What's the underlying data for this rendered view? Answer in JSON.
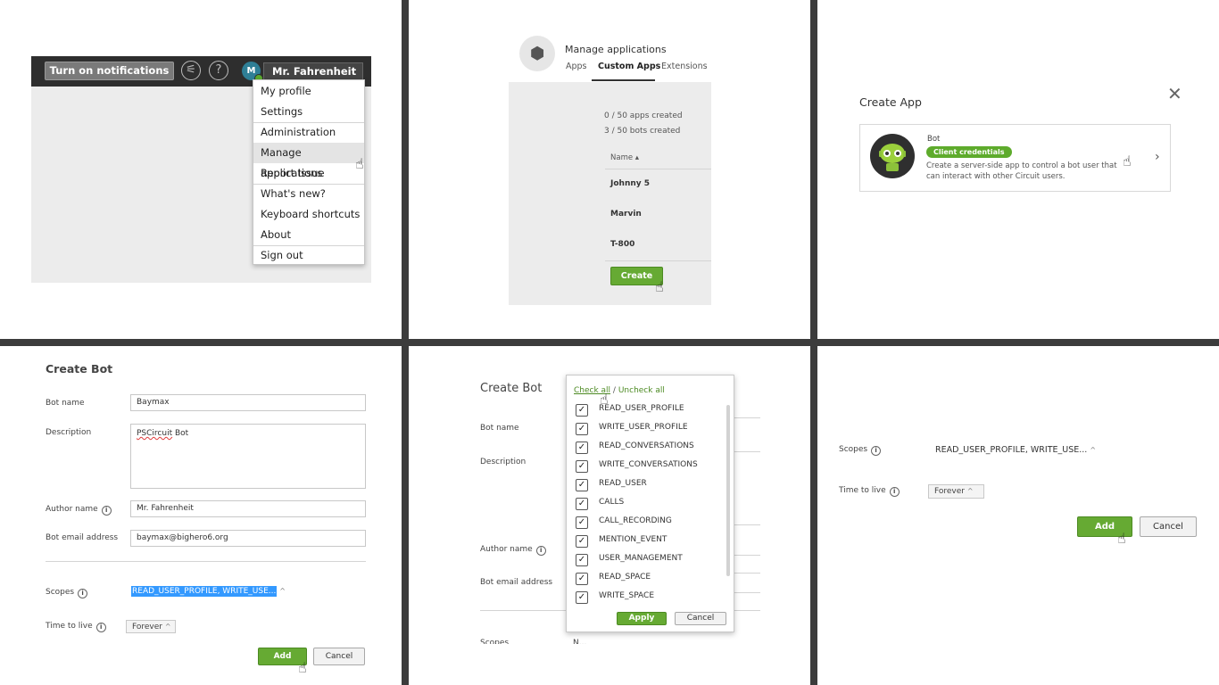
{
  "colors": {
    "brand_green": "#66aa33",
    "top_bar": "#2e2e2e",
    "selection_blue": "#3399ff",
    "badge_green": "#5eab2c"
  },
  "panel1": {
    "notifications_button": "Turn on notifications",
    "phone_icon": "⚟",
    "help_icon": "?",
    "avatar_initial": "M",
    "user_menu_button": "Mr. Fahrenheit",
    "user_menu_caret": "⌄",
    "menu": {
      "my_profile": "My profile",
      "settings": "Settings",
      "administration": "Administration",
      "manage_applications": "Manage applications",
      "report_issue": "Report Issue",
      "whats_new": "What's new?",
      "keyboard_shortcuts": "Keyboard shortcuts",
      "about": "About",
      "sign_out": "Sign out"
    }
  },
  "panel2": {
    "app_icon": "⬢",
    "title": "Manage applications",
    "tabs": {
      "apps": "Apps",
      "custom_apps": "Custom Apps",
      "extensions": "Extensions"
    },
    "apps_created": "0 / 50 apps created",
    "bots_created": "3 / 50 bots created",
    "name_header": "Name",
    "sort_icon": "▴",
    "rows": [
      "Johnny 5",
      "Marvin",
      "T-800"
    ],
    "create_button": "Create"
  },
  "panel3": {
    "title": "Create App",
    "close_icon": "✕",
    "card_label": "Bot",
    "badge": "Client credentials",
    "description": "Create a server-side app to control a bot user that can interact with other Circuit users.",
    "chevron": "›"
  },
  "panel4": {
    "title": "Create Bot",
    "bot_name_label": "Bot name",
    "bot_name_value": "Baymax",
    "description_label": "Description",
    "description_value_marked": "PSCircuit",
    "description_value_rest": " Bot",
    "author_label": "Author name",
    "author_value": "Mr. Fahrenheit",
    "email_label": "Bot email address",
    "email_value": "baymax@bighero6.org",
    "scopes_label": "Scopes",
    "scopes_value": "READ_USER_PROFILE, WRITE_USE...",
    "ttl_label": "Time to live",
    "ttl_value": "Forever",
    "add_button": "Add",
    "cancel_button": "Cancel",
    "info_icon": "i",
    "caret_up": "^"
  },
  "panel5": {
    "title": "Create Bot",
    "bot_name_label": "Bot name",
    "description_label": "Description",
    "author_label": "Author name",
    "email_label": "Bot email address",
    "scopes_label_partial": "Scopes",
    "scopes_value_partial": "N...",
    "check_all": "Check all",
    "separator": " / ",
    "uncheck_all": "Uncheck all",
    "check_mark": "✓",
    "scopes": [
      "READ_USER_PROFILE",
      "WRITE_USER_PROFILE",
      "READ_CONVERSATIONS",
      "WRITE_CONVERSATIONS",
      "READ_USER",
      "CALLS",
      "CALL_RECORDING",
      "MENTION_EVENT",
      "USER_MANAGEMENT",
      "READ_SPACE",
      "WRITE_SPACE"
    ],
    "apply_button": "Apply",
    "cancel_button": "Cancel",
    "info_icon": "i"
  },
  "panel6": {
    "scopes_label": "Scopes",
    "scopes_value": "READ_USER_PROFILE, WRITE_USE...",
    "ttl_label": "Time to live",
    "ttl_value": "Forever",
    "add_button": "Add",
    "cancel_button": "Cancel",
    "info_icon": "i",
    "caret_up": "^"
  },
  "cursor_glyph": "☝"
}
